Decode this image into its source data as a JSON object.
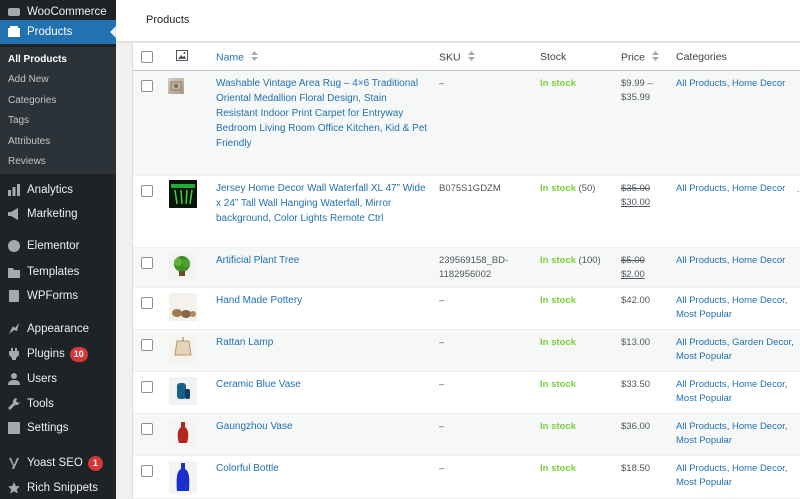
{
  "sidebar": {
    "top": [
      {
        "label": "WooCommerce",
        "icon": "woocommerce-icon"
      },
      {
        "label": "Products",
        "icon": "products-icon",
        "active": true
      }
    ],
    "submenu": [
      "All Products",
      "Add New",
      "Categories",
      "Tags",
      "Attributes",
      "Reviews"
    ],
    "items": [
      {
        "label": "Analytics",
        "icon": "analytics-icon"
      },
      {
        "label": "Marketing",
        "icon": "marketing-icon"
      },
      {
        "label": "Elementor",
        "icon": "elementor-icon"
      },
      {
        "label": "Templates",
        "icon": "templates-icon"
      },
      {
        "label": "WPForms",
        "icon": "wpforms-icon"
      },
      {
        "label": "Appearance",
        "icon": "appearance-icon"
      },
      {
        "label": "Plugins",
        "icon": "plugins-icon",
        "badge": "10"
      },
      {
        "label": "Users",
        "icon": "users-icon"
      },
      {
        "label": "Tools",
        "icon": "tools-icon"
      },
      {
        "label": "Settings",
        "icon": "settings-icon"
      },
      {
        "label": "Yoast SEO",
        "icon": "yoast-icon",
        "badge": "1"
      },
      {
        "label": "Rich Snippets",
        "icon": "star-icon"
      }
    ]
  },
  "header": {
    "title": "Products"
  },
  "table": {
    "columns": {
      "name": "Name",
      "sku": "SKU",
      "stock": "Stock",
      "price": "Price",
      "categories": "Categories",
      "image": "image-icon"
    },
    "rows": [
      {
        "name": "Washable Vintage Area Rug – 4×6 Traditional Oriental Medallion Floral Design, Stain Resistant Indoor Print Carpet for Entryway Bedroom Living Room Office Kitchen, Kid & Pet Friendly",
        "sku": "–",
        "stock": "In stock",
        "qty": "",
        "price_regular": "$9.99 –",
        "price_sale": "$35.99",
        "price_type": "range",
        "categories": [
          "All Products",
          "Home Decor"
        ],
        "thumb": "rug"
      },
      {
        "name": "Jersey Home Decor Wall Waterfall XL 47” Wide x 24” Tall Wall Hanging Waterfall, Mirror background, Color Lights Remote Ctrl",
        "sku": "B075S1GDZM",
        "stock": "In stock",
        "qty": " (50)",
        "price_regular": "$35.00",
        "price_sale": "$30.00",
        "price_type": "sale",
        "categories": [
          "All Products",
          "Home Decor"
        ],
        "thumb": "waterfall"
      },
      {
        "name": "Artificial Plant Tree",
        "sku": "239569158_BD-1182956002",
        "stock": "In stock",
        "qty": " (100)",
        "price_regular": "$5.00",
        "price_sale": "$2.00",
        "price_type": "sale",
        "categories": [
          "All Products",
          "Home Decor"
        ],
        "thumb": "plant"
      },
      {
        "name": "Hand Made Pottery",
        "sku": "–",
        "stock": "In stock",
        "qty": "",
        "price_regular": "$42.00",
        "price_sale": "",
        "price_type": "single",
        "categories": [
          "All Products",
          "Home Decor",
          "Most Popular"
        ],
        "thumb": "pottery"
      },
      {
        "name": "Rattan Lamp",
        "sku": "–",
        "stock": "In stock",
        "qty": "",
        "price_regular": "$13.00",
        "price_sale": "",
        "price_type": "single",
        "categories": [
          "All Products",
          "Garden Decor",
          "Most Popular"
        ],
        "thumb": "lamp"
      },
      {
        "name": "Ceramic Blue Vase",
        "sku": "–",
        "stock": "In stock",
        "qty": "",
        "price_regular": "$33.50",
        "price_sale": "",
        "price_type": "single",
        "categories": [
          "All Products",
          "Home Decor",
          "Most Popular"
        ],
        "thumb": "bluevase"
      },
      {
        "name": "Gaungzhou Vase",
        "sku": "–",
        "stock": "In stock",
        "qty": "",
        "price_regular": "$36.00",
        "price_sale": "",
        "price_type": "single",
        "categories": [
          "All Products",
          "Home Decor",
          "Most Popular"
        ],
        "thumb": "redvase"
      },
      {
        "name": "Colorful Bottle",
        "sku": "–",
        "stock": "In stock",
        "qty": "",
        "price_regular": "$18.50",
        "price_sale": "",
        "price_type": "single",
        "categories": [
          "All Products",
          "Home Decor",
          "Most Popular"
        ],
        "thumb": "bottle"
      }
    ]
  },
  "colors": {
    "admin_bar": "#1d2327",
    "submenu": "#2c3338",
    "accent": "#2271b1",
    "in_stock": "#7ad03a",
    "badge": "#d63638"
  }
}
